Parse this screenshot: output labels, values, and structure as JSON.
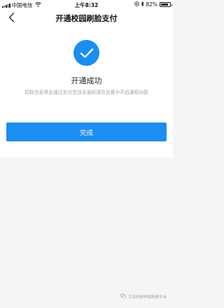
{
  "status_bar": {
    "carrier": "中国电信",
    "time": "上午8:32",
    "battery_percent": "82%",
    "battery_level": 0.82,
    "icons": [
      "signal-icon",
      "wifi-icon",
      "location-icon",
      "bluetooth-icon",
      "battery-icon"
    ]
  },
  "nav": {
    "title": "开通校园刷脸支付",
    "back_icon": "chevron-left-icon"
  },
  "result": {
    "icon": "check-circle-icon",
    "accent_color": "#1b8ef0",
    "title": "开通成功",
    "description": "扣款信息将会通过支付宝消息通知请在设置中开启通知功能"
  },
  "actions": {
    "done_label": "完成"
  },
  "watermark": {
    "text": "江苏科技学院刷费平台"
  }
}
